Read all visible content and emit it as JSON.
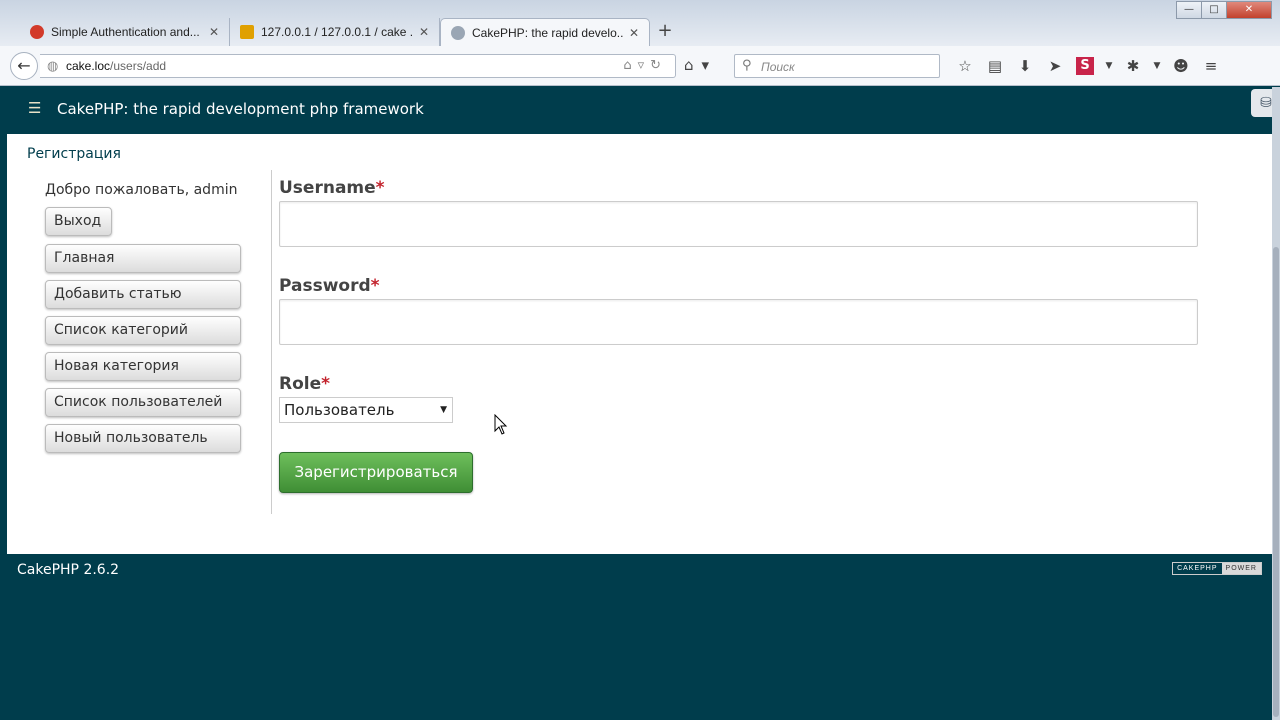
{
  "browser": {
    "tabs": [
      {
        "label": "Simple Authentication and...",
        "active": false,
        "favicon_color": "#d23a2a"
      },
      {
        "label": "127.0.0.1 / 127.0.0.1 / cake ...",
        "active": false,
        "favicon_color": "#e0a000"
      },
      {
        "label": "CakePHP: the rapid develo...",
        "active": true,
        "favicon_color": "#9aa6b4"
      }
    ],
    "url_host": "cake.loc",
    "url_path": "/users/add",
    "search_placeholder": "Поиск",
    "icons": [
      "back-arrow-icon",
      "globe-icon",
      "reload-icon",
      "home-icon",
      "search-icon",
      "star-icon",
      "bookmarks-icon",
      "download-icon",
      "send-icon",
      "s-addon-icon",
      "bug-icon",
      "chat-icon",
      "menu-icon"
    ]
  },
  "header": {
    "title": "CakePHP: the rapid development php framework"
  },
  "page": {
    "breadcrumb": "Регистрация"
  },
  "sidebar": {
    "welcome": "Добро пожаловать, admin",
    "logout": "Выход",
    "items": [
      {
        "label": "Главная"
      },
      {
        "label": "Добавить статью"
      },
      {
        "label": "Список категорий"
      },
      {
        "label": "Новая категория"
      },
      {
        "label": "Список пользователей"
      },
      {
        "label": "Новый пользователь"
      }
    ]
  },
  "form": {
    "username_label": "Username",
    "username_value": "",
    "password_label": "Password",
    "password_value": "",
    "role_label": "Role",
    "role_selected": "Пользователь",
    "required_marker": "*",
    "submit": "Зарегистрироваться"
  },
  "footer": {
    "version": "CakePHP 2.6.2",
    "power_left": "CAKEPHP",
    "power_right": "POWER"
  },
  "colors": {
    "brand": "#003d4c",
    "required": "#c3232d",
    "submit_green": "#4f9f43"
  }
}
